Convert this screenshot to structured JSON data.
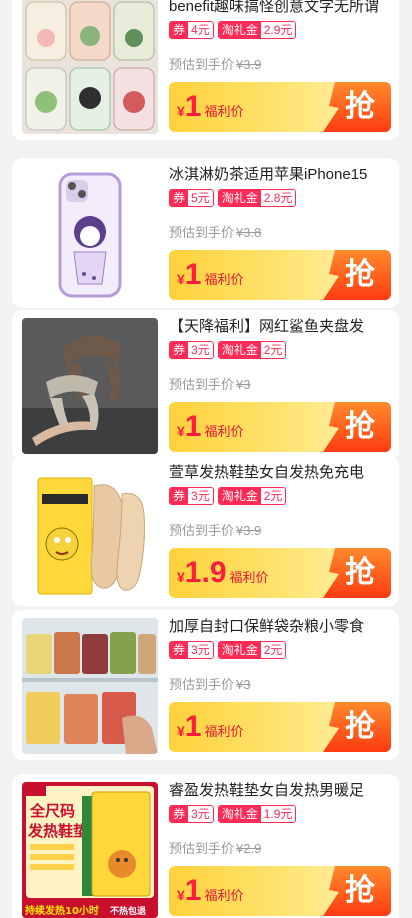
{
  "colors": {
    "accent": "#ff2a55",
    "price": "#ff1b3b",
    "button": "#ff5a1f",
    "banner_start": "#ffd23a"
  },
  "products": [
    {
      "title": "benefit趣味搞怪创意文字无所谓",
      "coupon_label": "券",
      "coupon_value": "4元",
      "gift_label": "淘礼金",
      "gift_value": "2.9元",
      "est_label": "预估到手价",
      "est_price": "¥3.9",
      "price_symbol": "¥",
      "price_value": "1",
      "price_tag": "福利价",
      "buy_label": "抢",
      "image": "phone-case-grid"
    },
    {
      "title": "冰淇淋奶茶适用苹果iPhone15",
      "coupon_label": "券",
      "coupon_value": "5元",
      "gift_label": "淘礼金",
      "gift_value": "2.8元",
      "est_label": "预估到手价",
      "est_price": "¥3.8",
      "price_symbol": "¥",
      "price_value": "1",
      "price_tag": "福利价",
      "buy_label": "抢",
      "image": "purple-phone-case"
    },
    {
      "title": "【天降福利】网红鲨鱼夹盘发",
      "coupon_label": "券",
      "coupon_value": "3元",
      "gift_label": "淘礼金",
      "gift_value": "2元",
      "est_label": "预估到手价",
      "est_price": "¥3",
      "price_symbol": "¥",
      "price_value": "1",
      "price_tag": "福利价",
      "buy_label": "抢",
      "image": "hair-claw-clips"
    },
    {
      "title": "萱草发热鞋垫女自发热免充电",
      "coupon_label": "券",
      "coupon_value": "3元",
      "gift_label": "淘礼金",
      "gift_value": "2元",
      "est_label": "预估到手价",
      "est_price": "¥3.9",
      "price_symbol": "¥",
      "price_value": "1.9",
      "price_tag": "福利价",
      "buy_label": "抢",
      "image": "heated-insoles"
    },
    {
      "title": "加厚自封口保鲜袋杂粮小零食",
      "coupon_label": "券",
      "coupon_value": "3元",
      "gift_label": "淘礼金",
      "gift_value": "2元",
      "est_label": "预估到手价",
      "est_price": "¥3",
      "price_symbol": "¥",
      "price_value": "1",
      "price_tag": "福利价",
      "buy_label": "抢",
      "image": "freezer-bags"
    },
    {
      "title": "睿盈发热鞋垫女自发热男暖足",
      "coupon_label": "券",
      "coupon_value": "3元",
      "gift_label": "淘礼金",
      "gift_value": "1.9元",
      "est_label": "预估到手价",
      "est_price": "¥2.9",
      "price_symbol": "¥",
      "price_value": "1",
      "price_tag": "福利价",
      "buy_label": "抢",
      "image": "heated-insole-box",
      "image_text": {
        "line1": "全尺码",
        "line2": "发热鞋垫",
        "footer": "持续发热10小时",
        "footer_tag": "不热包退"
      }
    }
  ]
}
